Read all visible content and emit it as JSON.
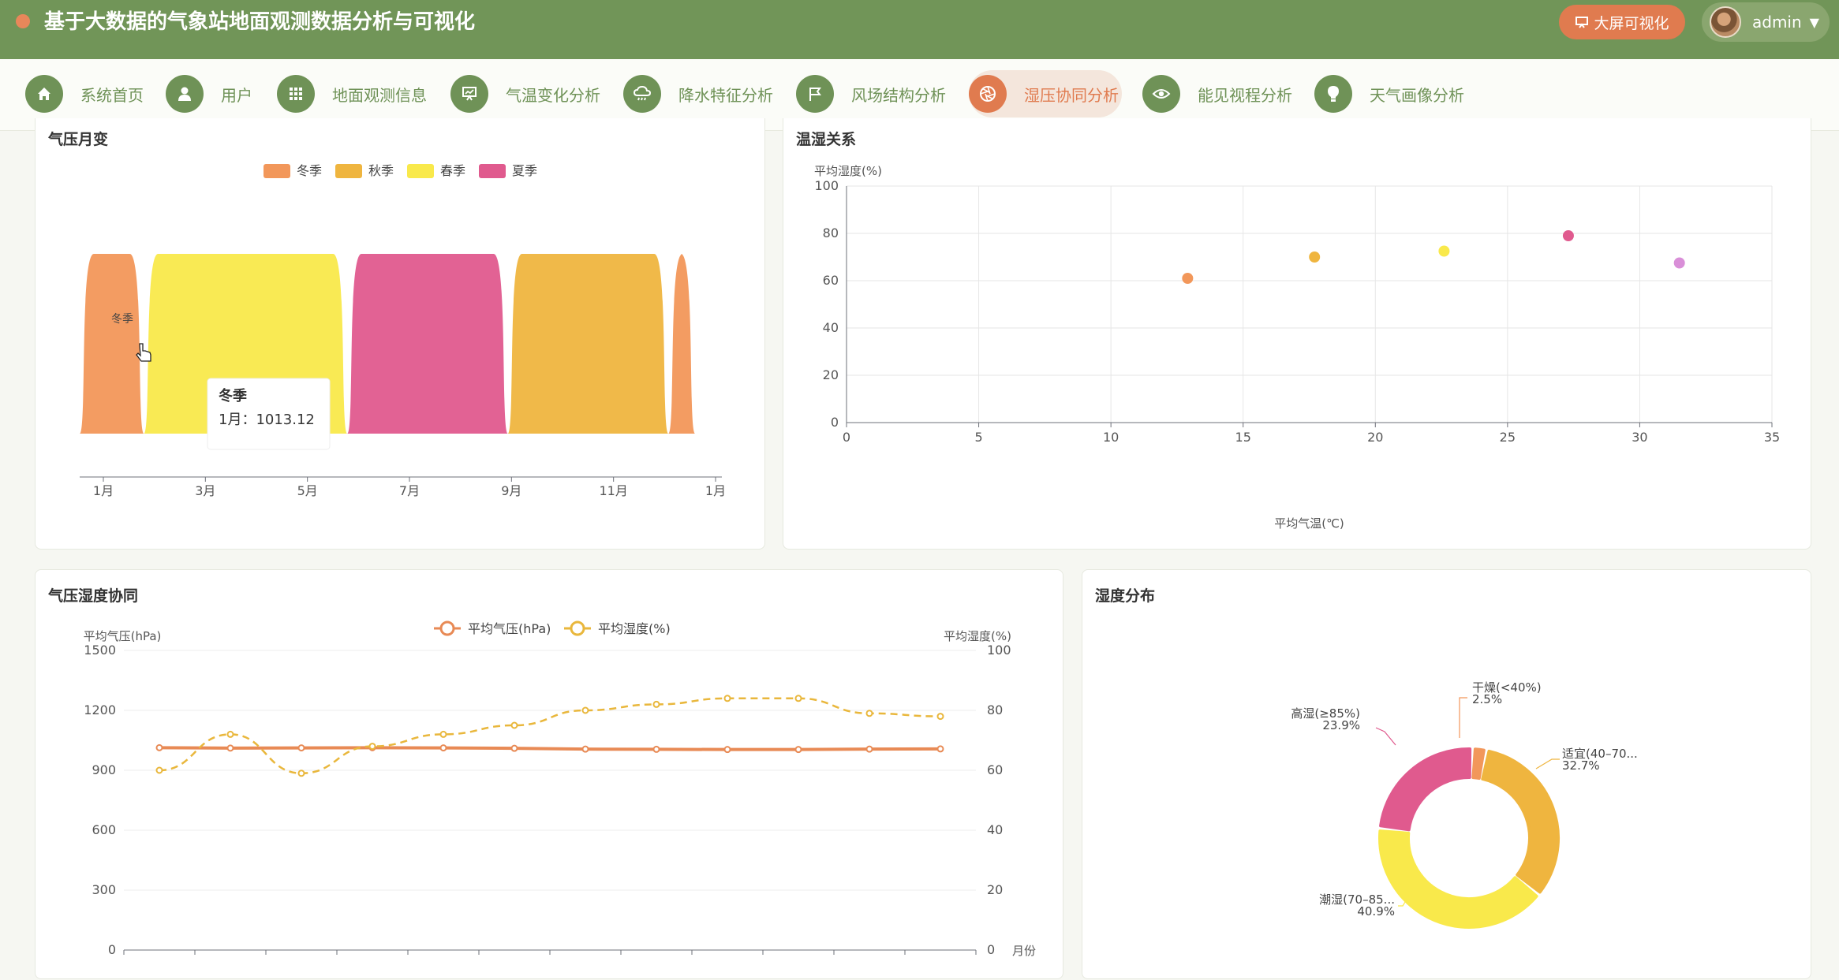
{
  "header": {
    "title": "基于大数据的气象站地面观测数据分析与可视化",
    "bigscreen_label": "大屏可视化",
    "user_name": "admin"
  },
  "nav": [
    {
      "label": "系统首页",
      "icon": "home-icon"
    },
    {
      "label": "用户",
      "icon": "user-icon"
    },
    {
      "label": "地面观测信息",
      "icon": "grid-icon"
    },
    {
      "label": "气温变化分析",
      "icon": "chart-board-icon"
    },
    {
      "label": "降水特征分析",
      "icon": "cloud-rain-icon"
    },
    {
      "label": "风场结构分析",
      "icon": "flag-icon"
    },
    {
      "label": "湿压协同分析",
      "icon": "aperture-icon",
      "active": true
    },
    {
      "label": "能见视程分析",
      "icon": "eye-icon"
    },
    {
      "label": "天气画像分析",
      "icon": "bulb-icon"
    }
  ],
  "colors": {
    "header_bg": "#719558",
    "accent": "#e07b4f",
    "winter": "#f2975a",
    "autumn": "#efb53f",
    "spring": "#f9e94b",
    "summer": "#e05a8e",
    "scatter_extra": "#d98fd8"
  },
  "cards": {
    "pressure_monthly": "气压月变",
    "temp_humidity": "温湿关系",
    "pressure_humidity": "气压湿度协同",
    "humidity_dist": "湿度分布"
  },
  "chart_data": [
    {
      "id": "pressure_monthly",
      "type": "area",
      "title": "气压月变",
      "legend": [
        "冬季",
        "秋季",
        "春季",
        "夏季"
      ],
      "x_ticks": [
        "1月",
        "3月",
        "5月",
        "7月",
        "9月",
        "11月",
        "1月"
      ],
      "bands": [
        {
          "name": "冬季",
          "from_month": 1,
          "to_month": 2.2
        },
        {
          "name": "春季",
          "from_month": 2.2,
          "to_month": 6
        },
        {
          "name": "夏季",
          "from_month": 6,
          "to_month": 9
        },
        {
          "name": "秋季",
          "from_month": 9,
          "to_month": 12
        },
        {
          "name": "冬季",
          "from_month": 12,
          "to_month": 12.5
        }
      ],
      "hover_label": "冬季",
      "tooltip": {
        "title": "冬季",
        "line": "1月：1013.12"
      }
    },
    {
      "id": "temp_humidity",
      "type": "scatter",
      "title": "温湿关系",
      "xlabel": "平均气温(℃)",
      "ylabel": "平均湿度(%)",
      "xlim": [
        0,
        35
      ],
      "ylim": [
        0,
        100
      ],
      "x_ticks": [
        0,
        5,
        10,
        15,
        20,
        25,
        30,
        35
      ],
      "y_ticks": [
        0,
        20,
        40,
        60,
        80,
        100
      ],
      "points": [
        {
          "x": 12.9,
          "y": 61,
          "color": "#f2975a"
        },
        {
          "x": 17.7,
          "y": 70,
          "color": "#efb53f"
        },
        {
          "x": 22.6,
          "y": 72.5,
          "color": "#f9e94b"
        },
        {
          "x": 27.3,
          "y": 79,
          "color": "#e05a8e"
        },
        {
          "x": 31.5,
          "y": 67.5,
          "color": "#d98fd8"
        }
      ]
    },
    {
      "id": "pressure_humidity",
      "type": "line",
      "title": "气压湿度协同",
      "ylabel_left": "平均气压(hPa)",
      "ylabel_right": "平均湿度(%)",
      "xlabel": "月份",
      "ylim_left": [
        0,
        1500
      ],
      "ylim_right": [
        0,
        100
      ],
      "y_ticks_left": [
        0,
        300,
        600,
        900,
        1200,
        1500
      ],
      "y_ticks_right": [
        0,
        20,
        40,
        60,
        80,
        100
      ],
      "series": [
        {
          "name": "平均气压(hPa)",
          "axis": "left",
          "color": "#e88a55",
          "values": [
            1013,
            1011,
            1012,
            1013,
            1012,
            1010,
            1006,
            1005,
            1004,
            1004,
            1006,
            1007
          ]
        },
        {
          "name": "平均湿度(%)",
          "axis": "right",
          "color": "#e9b73c",
          "dashed": true,
          "values": [
            60,
            72,
            59,
            68,
            72,
            75,
            80,
            82,
            84,
            84,
            79,
            78
          ]
        }
      ]
    },
    {
      "id": "humidity_dist",
      "type": "pie",
      "title": "湿度分布",
      "slices": [
        {
          "name": "干燥(<40%)",
          "pct_label": "2.5%",
          "value": 2.5,
          "color": "#f2975a"
        },
        {
          "name": "适宜(40–70...",
          "pct_label": "32.7%",
          "value": 32.7,
          "color": "#efb53f"
        },
        {
          "name": "潮湿(70–85...",
          "pct_label": "40.9%",
          "value": 40.9,
          "color": "#f9e94b"
        },
        {
          "name": "高湿(≥85%)",
          "pct_label": "23.9%",
          "value": 23.9,
          "color": "#e05a8e"
        }
      ]
    }
  ]
}
